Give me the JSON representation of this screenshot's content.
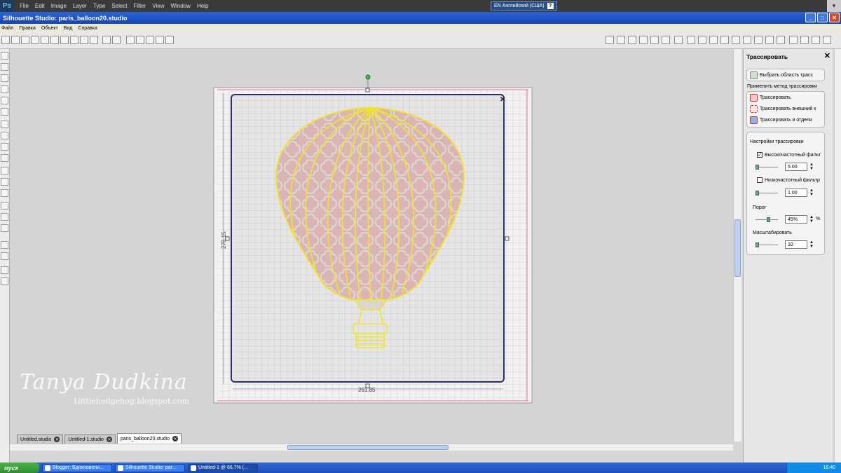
{
  "ps_bar": {
    "logo": "Ps",
    "menu": [
      "File",
      "Edit",
      "Image",
      "Layer",
      "Type",
      "Select",
      "Filter",
      "View",
      "Window",
      "Help"
    ],
    "language": "EN Английский (США)",
    "help_glyph": "?"
  },
  "window": {
    "title": "Silhouette Studio: paris_balloon20.studio",
    "minimize": "_",
    "maximize": "□",
    "close": "✕"
  },
  "menubar": [
    "Файл",
    "Правка",
    "Объект",
    "Вид",
    "Справка"
  ],
  "canvas": {
    "width_label": "261.85",
    "height_label": "276.15",
    "close_glyph": "✕"
  },
  "tabs": [
    {
      "label": "Untitled.studio",
      "active": false
    },
    {
      "label": "Untitled-1.studio",
      "active": false
    },
    {
      "label": "paris_balloon20.studio",
      "active": true
    }
  ],
  "trace_panel": {
    "title": "Трассировать",
    "close": "✕",
    "select_area": "Выбрать область трасс",
    "apply_method": "Применить метод трассировки",
    "methods": [
      "Трассировать",
      "Трассировать внешний к",
      "Трассировать и отдели"
    ],
    "settings_title": "Настройки трассировки",
    "high_pass": {
      "label": "Высокочастотный фильт",
      "checked": true,
      "value": "5.00"
    },
    "low_pass": {
      "label": "Низкочастотный фильтр",
      "checked": false,
      "value": "1.00"
    },
    "threshold": {
      "label": "Порог",
      "value": "45%",
      "unit": "%"
    },
    "scale": {
      "label": "Масштабировать",
      "value": "10"
    }
  },
  "watermark": {
    "name": "Tanya Dudkina",
    "url": "1littlehedgehog.blogspot.com"
  },
  "taskbar": {
    "start": "пуск",
    "tasks": [
      {
        "label": "Blogger: Вдохновени...",
        "active": false
      },
      {
        "label": "Silhouette Studio: par...",
        "active": false
      },
      {
        "label": "Untitled-1 @ 66,7% (...",
        "active": true
      }
    ],
    "time": "16:40"
  },
  "colors": {
    "balloon_fill": "#dbb5b5",
    "pattern": "#dcd6cc",
    "trace_line": "#f2e621",
    "mat_border": "#2a2f6b",
    "titlebar": "#1f55c8"
  }
}
